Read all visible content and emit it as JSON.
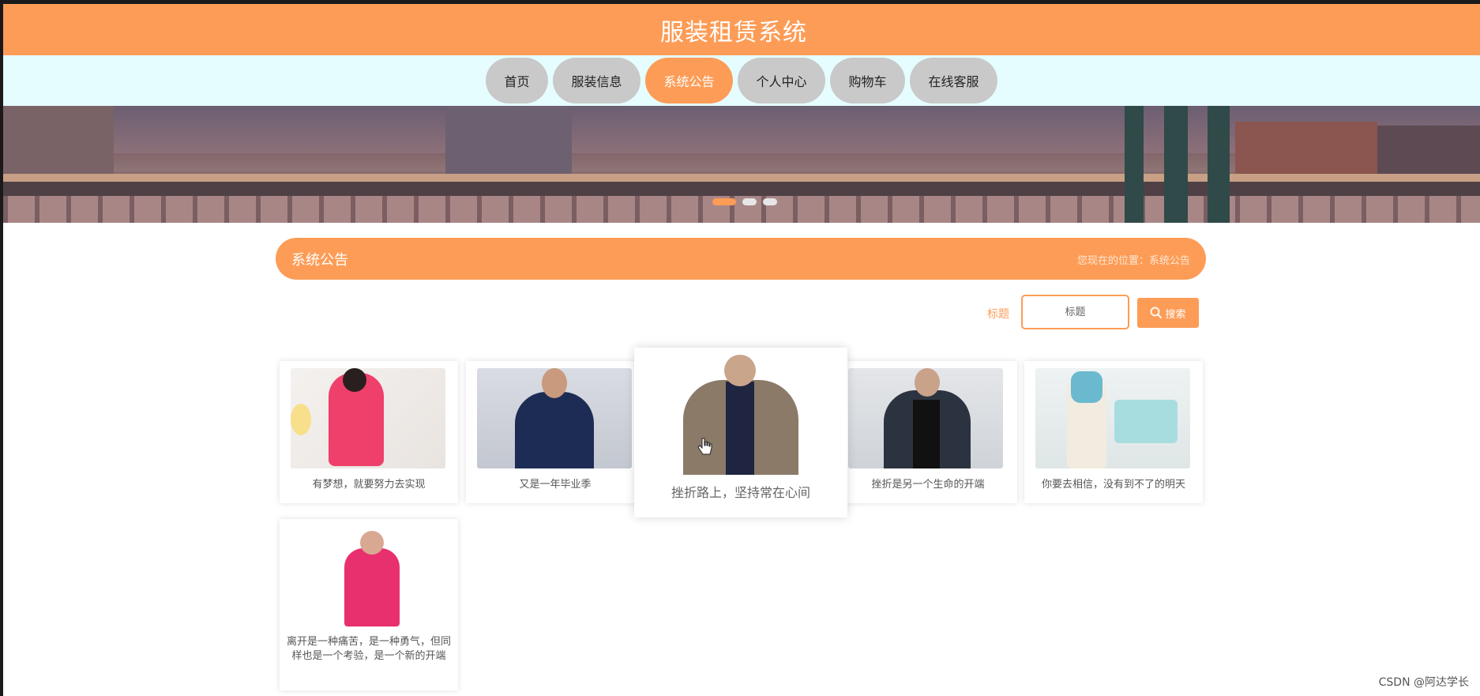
{
  "header": {
    "title": "服装租赁系统"
  },
  "nav": {
    "items": [
      {
        "label": "首页"
      },
      {
        "label": "服装信息"
      },
      {
        "label": "系统公告"
      },
      {
        "label": "个人中心"
      },
      {
        "label": "购物车"
      },
      {
        "label": "在线客服"
      }
    ],
    "active_index": 2
  },
  "banner": {
    "slide_count": 3,
    "active_slide": 0
  },
  "section": {
    "title": "系统公告",
    "breadcrumb_prefix": "您现在的位置：",
    "breadcrumb_current": "系统公告"
  },
  "search": {
    "label": "标题",
    "placeholder": "标题",
    "button_label": "搜索",
    "button_icon": "search-icon"
  },
  "cards": [
    {
      "caption": "有梦想，就要努力去实现"
    },
    {
      "caption": "又是一年毕业季"
    },
    {
      "caption": "挫折路上，坚持常在心间"
    },
    {
      "caption": "挫折是另一个生命的开端"
    },
    {
      "caption": "你要去相信，没有到不了的明天"
    },
    {
      "caption": "离开是一种痛苦，是一种勇气，但同样也是一个考验，是一个新的开端"
    }
  ],
  "colors": {
    "accent": "#fd9c56",
    "nav_bg": "#e6fdff",
    "nav_item": "#c9c9c9"
  },
  "watermark": "CSDN @阿达学长"
}
